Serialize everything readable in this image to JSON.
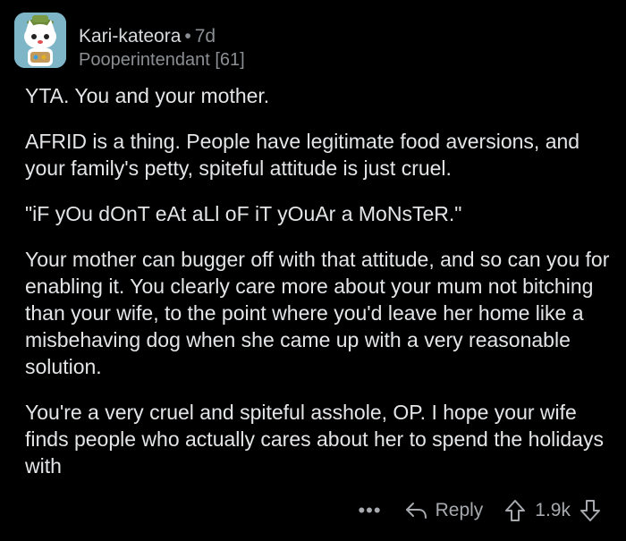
{
  "author": {
    "username": "Kari-kateora",
    "separator": "•",
    "age": "7d",
    "flair": "Pooperintendant [61]"
  },
  "comment": {
    "paragraphs": [
      "YTA. You and your mother.",
      "AFRID is a thing. People have legitimate food aversions, and your family's petty, spiteful attitude is just cruel.",
      "\"iF yOu dOnT eAt aLl oF iT yOuAr a MoNsTeR.\"",
      "Your mother can bugger off with that attitude, and so can you for enabling it. You clearly care more about your mum not bitching than your wife, to the point where you'd leave her home like a misbehaving dog when she came up with a very reasonable solution.",
      "You're a very cruel and spiteful asshole, OP. I hope your wife finds people who actually cares about her to spend the holidays with"
    ]
  },
  "actions": {
    "more_label": "•••",
    "reply_label": "Reply",
    "score": "1.9k",
    "icons": {
      "more": "more-options-icon",
      "reply": "reply-arrow-icon",
      "upvote": "upvote-arrow-icon",
      "downvote": "downvote-arrow-icon"
    }
  },
  "colors": {
    "background": "#000000",
    "text": "#e3e5e7",
    "muted": "#8b8f93",
    "avatar_bg": "#7eb6c8"
  }
}
